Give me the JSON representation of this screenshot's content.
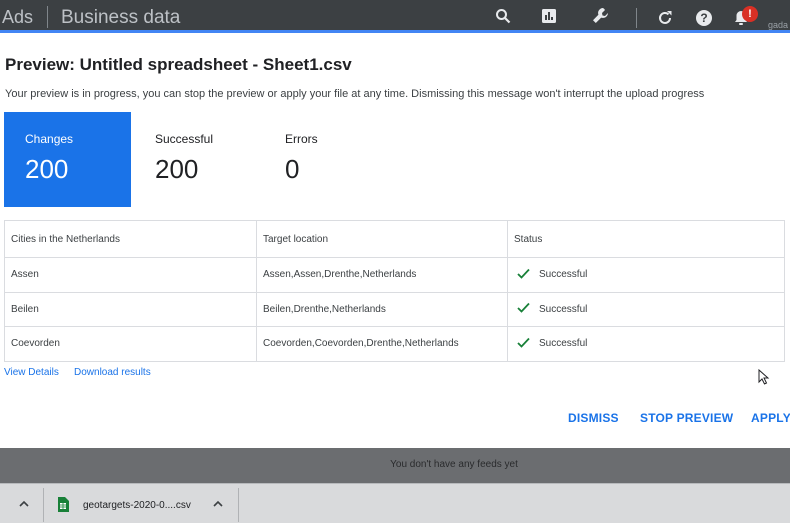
{
  "topbar": {
    "brand": "Ads",
    "section": "Business data",
    "icons": [
      "search-icon",
      "reports-icon",
      "tools-icon",
      "refresh-icon",
      "help-icon",
      "notifications-icon"
    ],
    "notification_badge": "!",
    "account": "gada"
  },
  "dialog": {
    "title": "Preview: Untitled spreadsheet - Sheet1.csv",
    "subtitle": "Your preview is in progress, you can stop the preview or apply your file at any time. Dismissing this message won't interrupt the upload progress",
    "stats": [
      {
        "label": "Changes",
        "value": "200"
      },
      {
        "label": "Successful",
        "value": "200"
      },
      {
        "label": "Errors",
        "value": "0"
      }
    ],
    "table": {
      "headers": [
        "Cities in the Netherlands",
        "Target location",
        "Status"
      ],
      "rows": [
        {
          "city": "Assen",
          "target": "Assen,Assen,Drenthe,Netherlands",
          "status": "Successful"
        },
        {
          "city": "Beilen",
          "target": "Beilen,Drenthe,Netherlands",
          "status": "Successful"
        },
        {
          "city": "Coevorden",
          "target": "Coevorden,Coevorden,Drenthe,Netherlands",
          "status": "Successful"
        }
      ]
    },
    "links": {
      "view_details": "View Details",
      "download_results": "Download results"
    },
    "actions": {
      "dismiss": "DISMISS",
      "stop_preview": "STOP PREVIEW",
      "apply": "APPLY"
    }
  },
  "background": {
    "feeds_message": "You don't have any feeds yet"
  },
  "download_bar": {
    "file_name": "geotargets-2020-0....csv"
  },
  "colors": {
    "accent": "#1a73e8",
    "topbar": "#3c4043",
    "success": "#188038",
    "badge": "#d93025"
  }
}
